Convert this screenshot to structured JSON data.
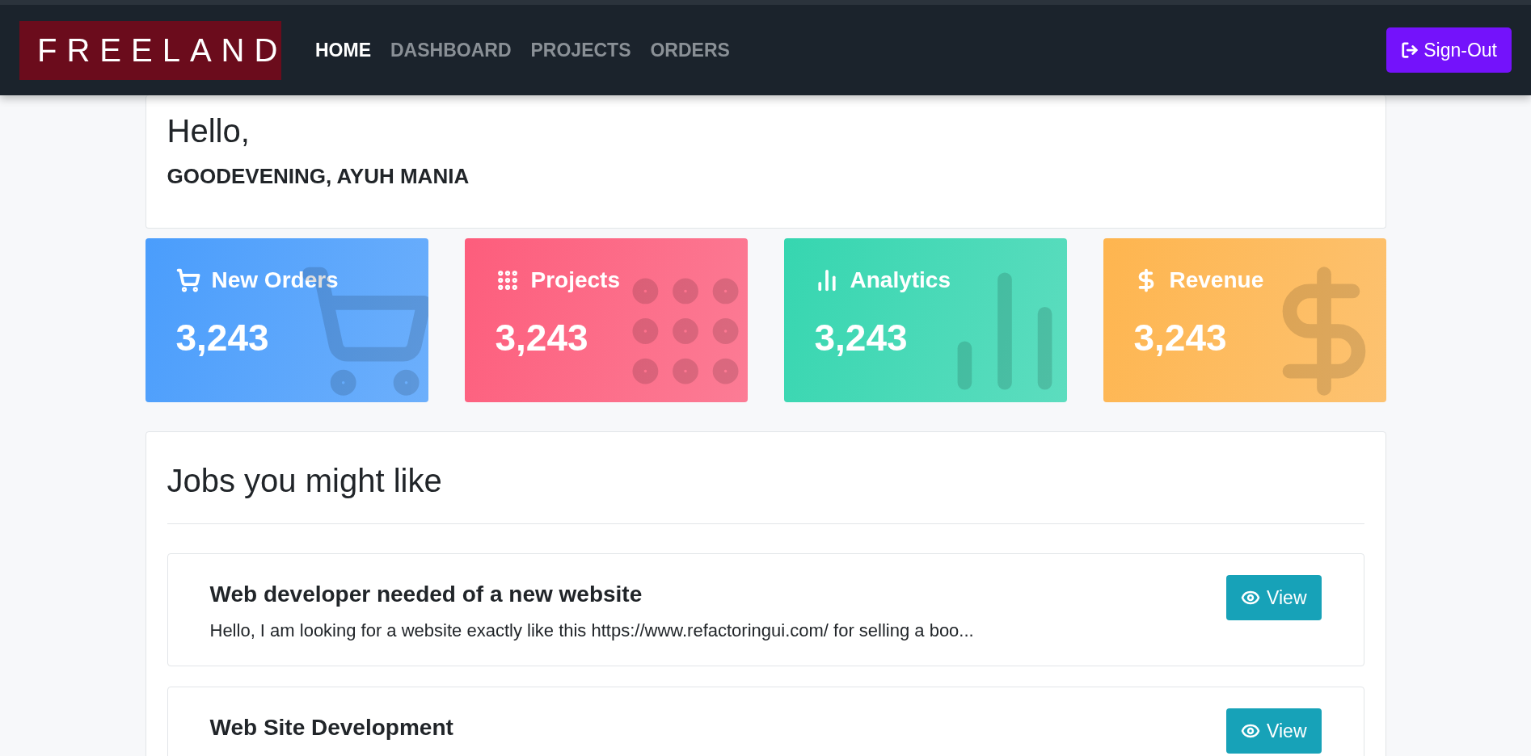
{
  "navbar": {
    "logo": "FREELAND",
    "links": [
      {
        "label": "HOME",
        "selected": true
      },
      {
        "label": "DASHBOARD",
        "selected": false
      },
      {
        "label": "PROJECTS",
        "selected": false
      },
      {
        "label": "ORDERS",
        "selected": false
      }
    ],
    "sign_out": "Sign-Out"
  },
  "greeting": {
    "title": "Hello,",
    "subtitle": "GOODEVENING, AYUH MANIA"
  },
  "stats": [
    {
      "kind": "cart",
      "label": "New Orders",
      "value": "3,243",
      "color": "#4a9dfc"
    },
    {
      "kind": "grid",
      "label": "Projects",
      "value": "3,243",
      "color": "#fd5d7c"
    },
    {
      "kind": "chart",
      "label": "Analytics",
      "value": "3,243",
      "color": "#36d6b0"
    },
    {
      "kind": "dollar",
      "label": "Revenue",
      "value": "3,243",
      "color": "#feb54f"
    }
  ],
  "jobs": {
    "title": "Jobs you might like",
    "items": [
      {
        "title": "Web developer needed of a new website",
        "description": "Hello, I am looking for a website exactly like this https://www.refactoringui.com/ for selling a boo...",
        "action": "View"
      },
      {
        "title": "Web Site Development",
        "action": "View"
      }
    ]
  }
}
